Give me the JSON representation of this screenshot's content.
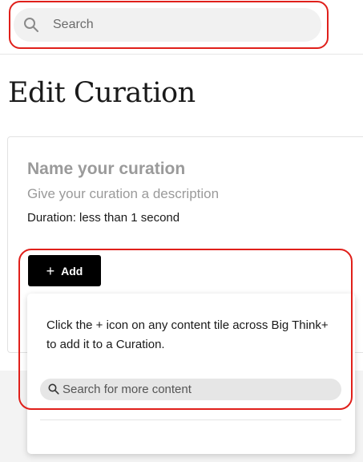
{
  "header": {
    "search_placeholder": "Search",
    "icon": "search-icon"
  },
  "page": {
    "title": "Edit Curation"
  },
  "curation": {
    "name_placeholder": "Name your curation",
    "description_placeholder": "Give your curation a description",
    "duration_text": "Duration: less than 1 second",
    "add_label": "Add",
    "add_icon": "plus-icon"
  },
  "add_panel": {
    "help_text": "Click the + icon on any content tile across Big Think+ to add it to a Curation.",
    "search_placeholder": "Search for more content",
    "icon": "search-icon"
  },
  "colors": {
    "highlight": "#e0201b",
    "button_bg": "#000000",
    "search_bg": "#f1f1f1",
    "placeholder_grey": "#9a9a9a"
  }
}
